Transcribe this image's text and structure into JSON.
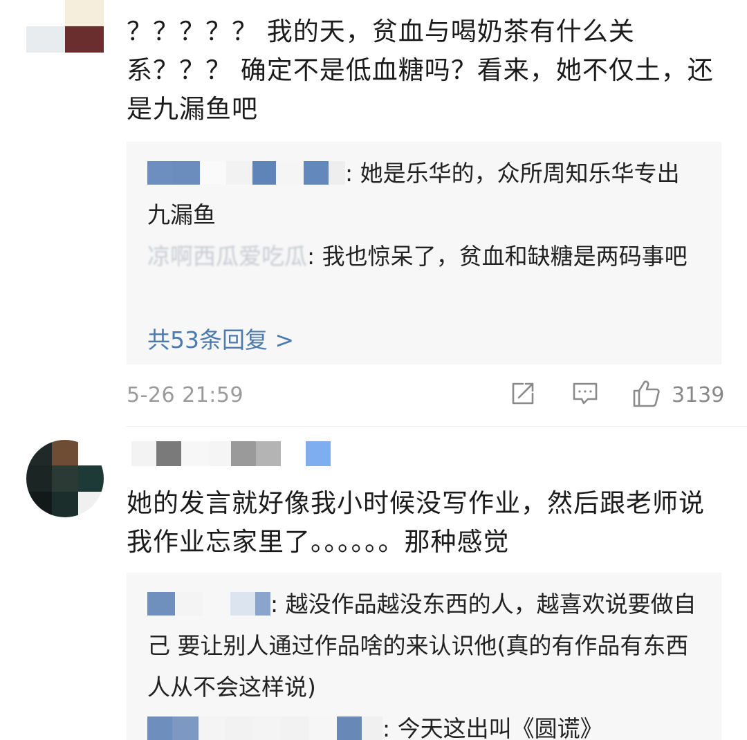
{
  "comments": [
    {
      "text": "？？？？？ 我的天，贫血与喝奶茶有什么关系？？？ 确定不是低血糖吗？看来，她不仅土，还是九漏鱼吧",
      "replies": [
        {
          "text": "她是乐华的，众所周知乐华专出九漏鱼"
        },
        {
          "name_blurred": "凉啊西瓜爱吃瓜",
          "text": "我也惊呆了，贫血和缺糖是两码事吧"
        }
      ],
      "more_replies": "共53条回复 >",
      "timestamp": "5-26 21:59",
      "likes": "3139"
    },
    {
      "text": "她的发言就好像我小时候没写作业，然后跟老师说我作业忘家里了。。。。。。那种感觉",
      "replies": [
        {
          "text": "越没作品越没东西的人，越喜欢说要做自己 要让别人通过作品啥的来认识他(真的有作品有东西人从不会这样说)"
        },
        {
          "text": "今天这出叫《圆谎》"
        }
      ]
    }
  ],
  "icons": {
    "share": "share-icon",
    "comment": "comment-icon",
    "like": "thumbs-up-icon"
  },
  "colors": {
    "link": "#4a7ab0",
    "reply_bg": "#f7f7f7",
    "meta": "#9a9a9a"
  }
}
